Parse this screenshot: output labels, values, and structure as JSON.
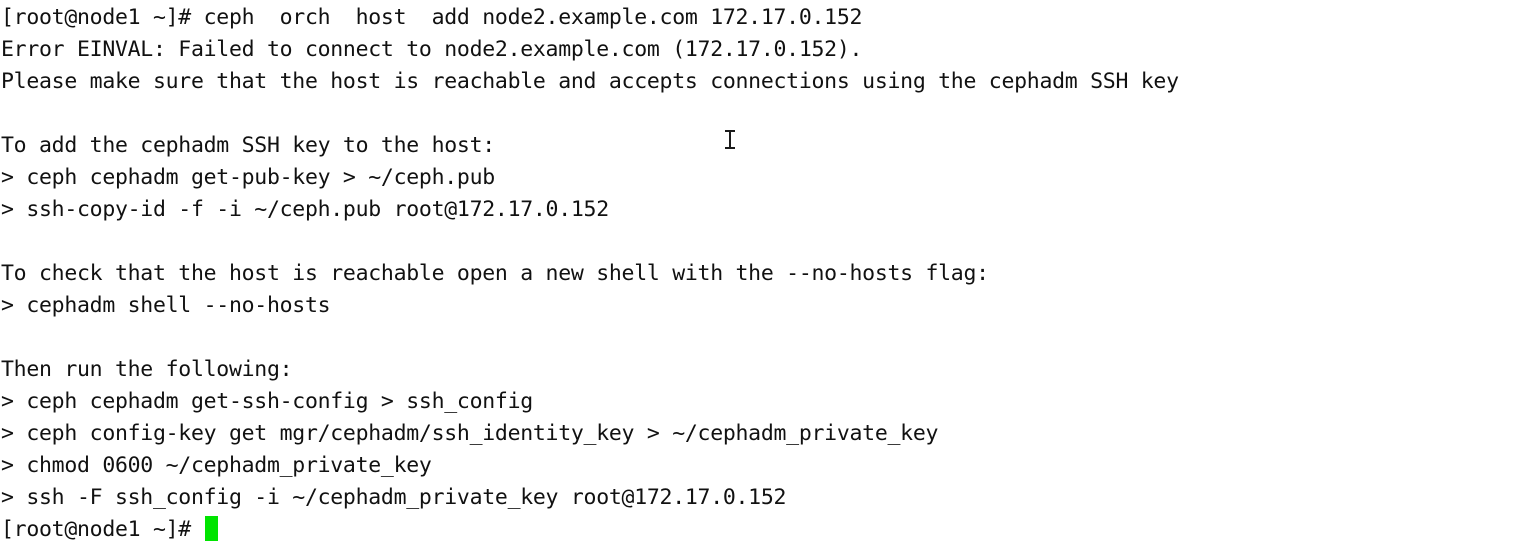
{
  "terminal": {
    "background_color": "#ffffff",
    "foreground_color": "#111111",
    "cursor_color": "#00e400",
    "lines": [
      "[root@node1 ~]# ceph  orch  host  add node2.example.com 172.17.0.152",
      "Error EINVAL: Failed to connect to node2.example.com (172.17.0.152).",
      "Please make sure that the host is reachable and accepts connections using the cephadm SSH key",
      "",
      "To add the cephadm SSH key to the host:",
      "> ceph cephadm get-pub-key > ~/ceph.pub",
      "> ssh-copy-id -f -i ~/ceph.pub root@172.17.0.152",
      "",
      "To check that the host is reachable open a new shell with the --no-hosts flag:",
      "> cephadm shell --no-hosts",
      "",
      "Then run the following:",
      "> ceph cephadm get-ssh-config > ssh_config",
      "> ceph config-key get mgr/cephadm/ssh_identity_key > ~/cephadm_private_key",
      "> chmod 0600 ~/cephadm_private_key",
      "> ssh -F ssh_config -i ~/cephadm_private_key root@172.17.0.152"
    ],
    "prompt": "[root@node1 ~]# ",
    "mouse_cursor_icon": "i-beam-text-cursor"
  }
}
